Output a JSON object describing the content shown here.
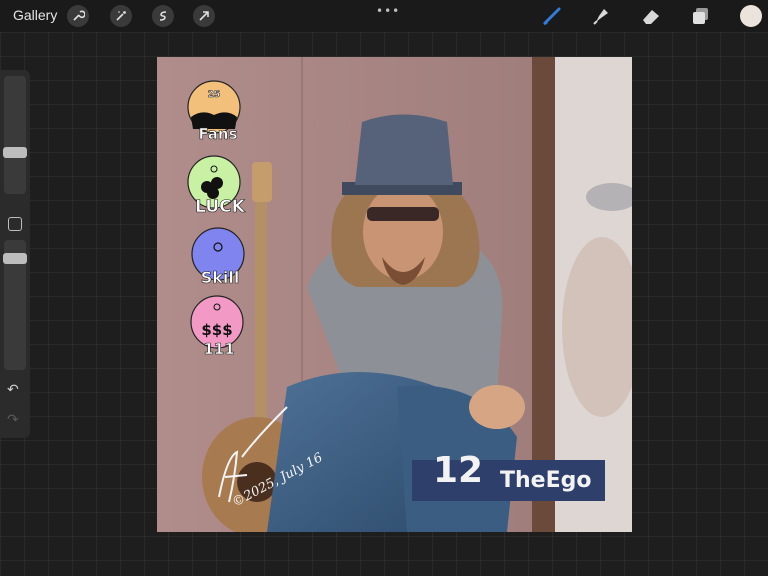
{
  "topbar": {
    "gallery_label": "Gallery",
    "left_tools": [
      "wrench-icon",
      "magic-wand-icon",
      "selection-icon",
      "transform-arrow-icon"
    ],
    "menu_dots": "•••",
    "right_tools": [
      "brush-icon",
      "smudge-icon",
      "eraser-icon",
      "layers-icon"
    ],
    "active_tool": "brush-icon",
    "current_color": "#ece4dc",
    "accent_color": "#2f7dd9"
  },
  "sidebar": {
    "undo_glyph": "↶",
    "redo_glyph": "↷"
  },
  "artwork": {
    "badges": [
      {
        "label": "Fans",
        "value": "25",
        "color": "#f3c07c"
      },
      {
        "label": "LUCK",
        "color": "#c8f1a4"
      },
      {
        "label": "Skill",
        "color": "#7f84ee"
      },
      {
        "label": "111",
        "color": "#f29ac5"
      }
    ],
    "signature_date": "©2025, July 16",
    "card_number": "12",
    "card_name": "TheEgo",
    "banner_color": "#2f3f6b"
  }
}
